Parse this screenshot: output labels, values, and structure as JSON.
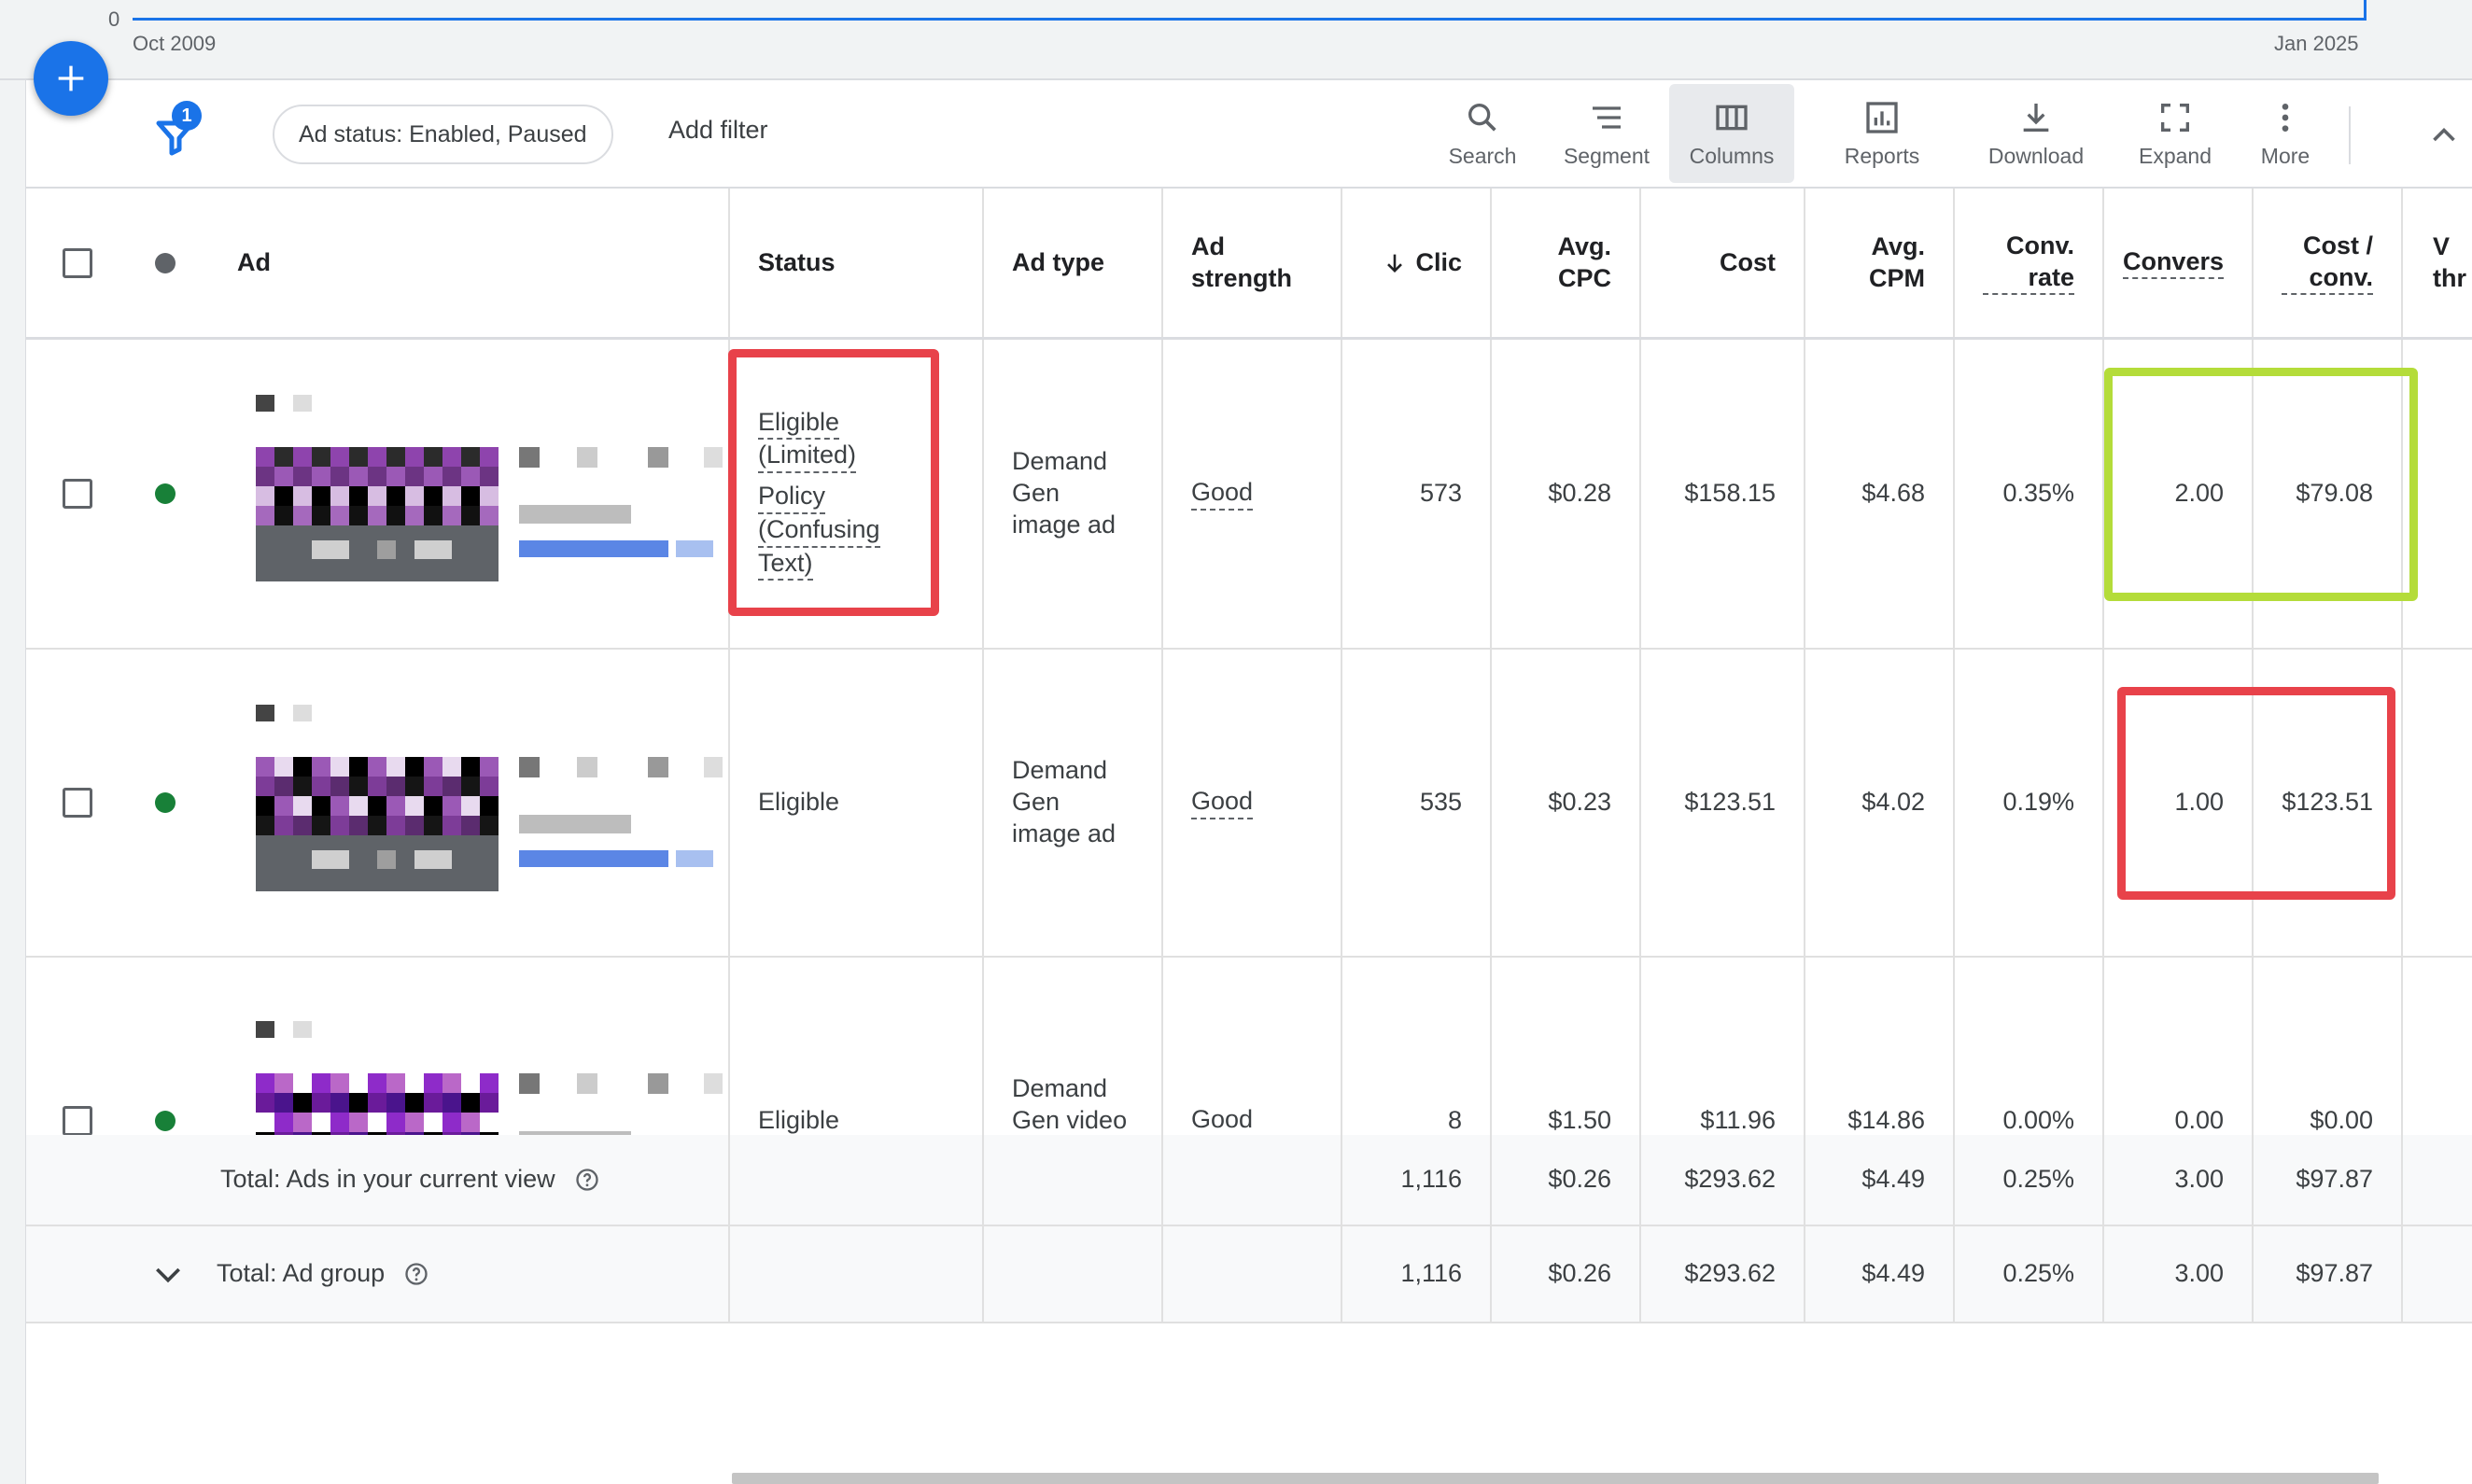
{
  "timeline": {
    "zero_label": "0",
    "start_label": "Oct 2009",
    "end_label": "Jan 2025",
    "line_color": "#1a73e8"
  },
  "fab": {
    "icon": "plus-icon"
  },
  "toolbar": {
    "filter_count": "1",
    "filter_chip": "Ad status: Enabled, Paused",
    "add_filter": "Add filter",
    "tools": [
      {
        "label": "Search",
        "icon": "search-icon"
      },
      {
        "label": "Segment",
        "icon": "segment-icon"
      },
      {
        "label": "Columns",
        "icon": "columns-icon",
        "active": true
      },
      {
        "label": "Reports",
        "icon": "reports-icon"
      },
      {
        "label": "Download",
        "icon": "download-icon"
      },
      {
        "label": "Expand",
        "icon": "expand-icon"
      },
      {
        "label": "More",
        "icon": "more-vert-icon"
      }
    ]
  },
  "table": {
    "headers": {
      "ad": "Ad",
      "status": "Status",
      "ad_type": "Ad type",
      "ad_strength": "Ad strength",
      "clicks": "Clic",
      "avg_cpc": "Avg. CPC",
      "cost": "Cost",
      "avg_cpm": "Avg. CPM",
      "conv_rate": "Conv. rate",
      "conversions": "Convers",
      "cost_per_conv": "Cost / conv.",
      "partial": "V thr"
    },
    "rows": [
      {
        "status_lines": [
          "Eligible",
          "(Limited)",
          "Policy",
          "(Confusing",
          "Text)"
        ],
        "ad_type": "Demand Gen image ad",
        "ad_strength": "Good",
        "clicks": "573",
        "avg_cpc": "$0.28",
        "cost": "$158.15",
        "avg_cpm": "$4.68",
        "conv_rate": "0.35%",
        "conversions": "2.00",
        "cost_per_conv": "$79.08"
      },
      {
        "status_lines": [
          "Eligible"
        ],
        "ad_type": "Demand Gen image ad",
        "ad_strength": "Good",
        "clicks": "535",
        "avg_cpc": "$0.23",
        "cost": "$123.51",
        "avg_cpm": "$4.02",
        "conv_rate": "0.19%",
        "conversions": "1.00",
        "cost_per_conv": "$123.51"
      },
      {
        "status_lines": [
          "Eligible"
        ],
        "ad_type": "Demand Gen video ad",
        "ad_strength": "Good",
        "clicks": "8",
        "avg_cpc": "$1.50",
        "cost": "$11.96",
        "avg_cpm": "$14.86",
        "conv_rate": "0.00%",
        "conversions": "0.00",
        "cost_per_conv": "$0.00"
      }
    ],
    "totals": [
      {
        "label": "Total: Ads in your current view",
        "clicks": "1,116",
        "avg_cpc": "$0.26",
        "cost": "$293.62",
        "avg_cpm": "$4.49",
        "conv_rate": "0.25%",
        "conversions": "3.00",
        "cost_per_conv": "$97.87"
      },
      {
        "label": "Total: Ad group",
        "clicks": "1,116",
        "avg_cpc": "$0.26",
        "cost": "$293.62",
        "avg_cpm": "$4.49",
        "conv_rate": "0.25%",
        "conversions": "3.00",
        "cost_per_conv": "$97.87"
      }
    ]
  },
  "highlights": {
    "red": "#e8424a",
    "green": "#b4dc3a"
  },
  "colors": {
    "status_enabled": "#188038",
    "accent": "#1a73e8"
  }
}
